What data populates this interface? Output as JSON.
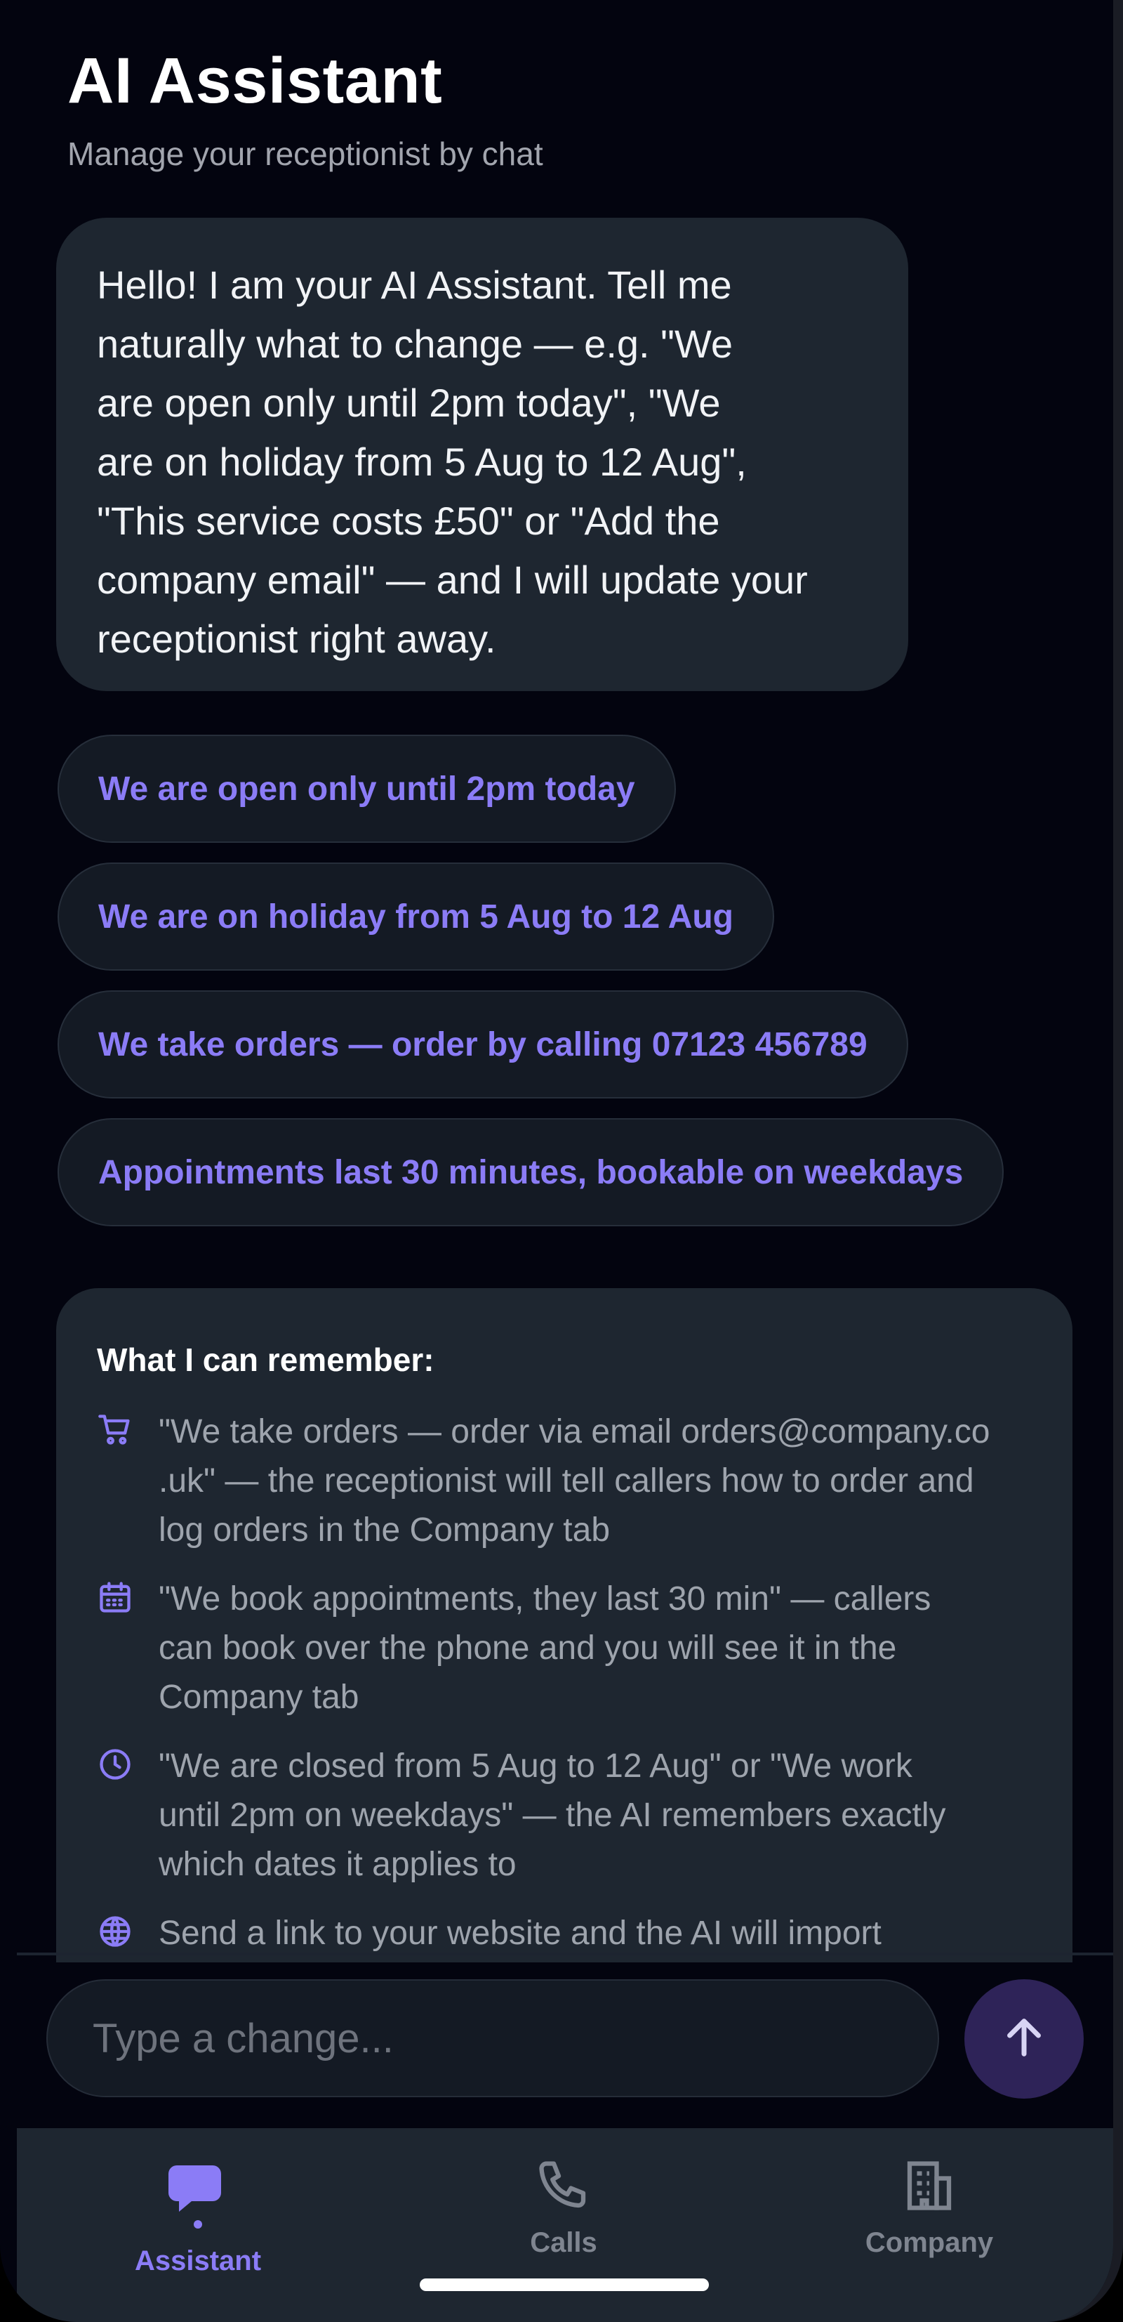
{
  "header": {
    "title": "AI Assistant",
    "subtitle": "Manage your receptionist by chat"
  },
  "assistant_message": {
    "lines": [
      "Hello! I am your AI Assistant. Tell me",
      "naturally what to change — e.g. \"We",
      "are open only until 2pm today\", \"We",
      "are on holiday from 5 Aug to 12 Aug\",",
      "\"This service costs £50\" or \"Add the",
      "company email\" — and I will update your",
      "receptionist right away."
    ]
  },
  "suggestions": [
    "We are open only until 2pm today",
    "We are on holiday from 5 Aug to 12 Aug",
    "We take orders — order by calling 07123 456789",
    "Appointments last 30 minutes, bookable on weekdays"
  ],
  "info": {
    "title": "What I can remember:",
    "items": [
      {
        "icon": "cart-icon",
        "lines": [
          "\"We take orders — order via email orders@company.co",
          ".uk\" — the receptionist will tell callers how to order and",
          "log orders in the Company tab"
        ]
      },
      {
        "icon": "calendar-icon",
        "lines": [
          "\"We book appointments, they last 30 min\" — callers",
          "can book over the phone and you will see it in the",
          "Company tab"
        ]
      },
      {
        "icon": "clock-icon",
        "lines": [
          "\"We are closed from 5 Aug to 12 Aug\" or \"We work",
          "until 2pm on weekdays\" — the AI remembers exactly",
          "which dates it applies to"
        ]
      },
      {
        "icon": "globe-icon",
        "lines": [
          "Send a link to your website and the AI will import"
        ]
      }
    ]
  },
  "composer": {
    "placeholder": "Type a change..."
  },
  "tabs": [
    {
      "label": "Assistant",
      "icon": "chat-bubbles-icon",
      "active": true
    },
    {
      "label": "Calls",
      "icon": "phone-icon",
      "active": false
    },
    {
      "label": "Company",
      "icon": "building-icon",
      "active": false
    }
  ],
  "colors": {
    "background": "#03040f",
    "bubble": "#1e2630",
    "accent": "#8b7cf6",
    "send_button": "#2e2358"
  }
}
